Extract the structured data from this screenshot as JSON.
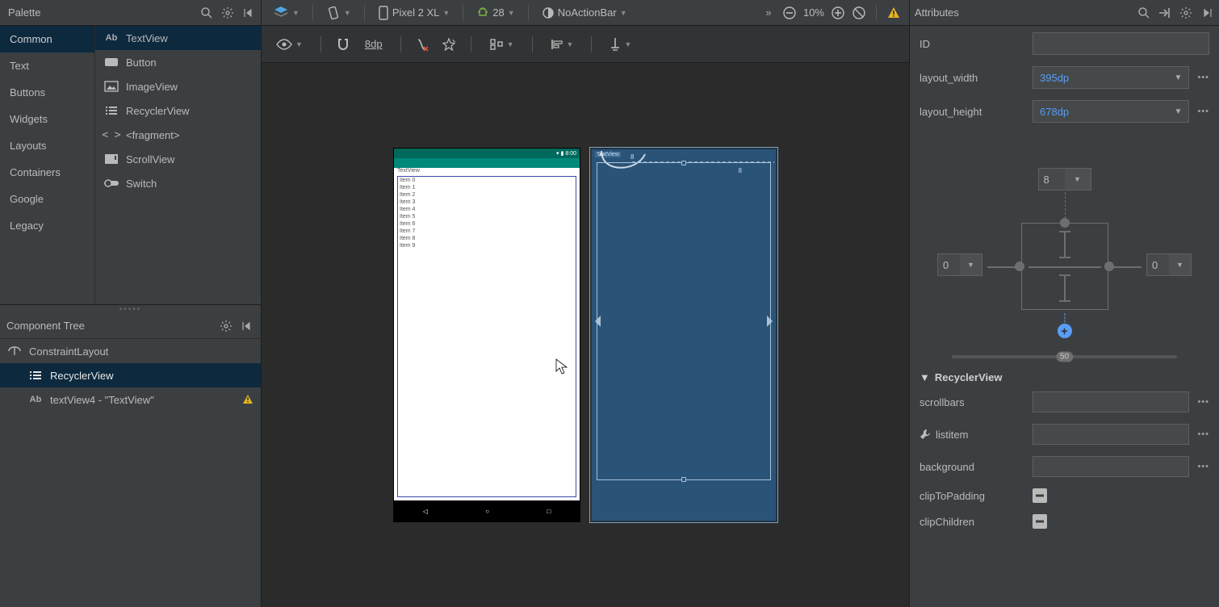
{
  "toolbar": {
    "palette_title": "Palette",
    "device": "Pixel 2 XL",
    "api": "28",
    "theme": "NoActionBar",
    "zoom": "10%",
    "default_margin": "8dp",
    "attributes_title": "Attributes"
  },
  "palette": {
    "categories": [
      "Common",
      "Text",
      "Buttons",
      "Widgets",
      "Layouts",
      "Containers",
      "Google",
      "Legacy"
    ],
    "active_category": 0,
    "items": [
      {
        "icon": "Ab",
        "label": "TextView"
      },
      {
        "icon": "btn",
        "label": "Button"
      },
      {
        "icon": "img",
        "label": "ImageView"
      },
      {
        "icon": "list",
        "label": "RecyclerView"
      },
      {
        "icon": "code",
        "label": "<fragment>"
      },
      {
        "icon": "scroll",
        "label": "ScrollView"
      },
      {
        "icon": "switch",
        "label": "Switch"
      }
    ],
    "selected_item": 0
  },
  "component_tree": {
    "title": "Component Tree",
    "rows": [
      {
        "icon": "constr",
        "label": "ConstraintLayout",
        "depth": 0,
        "warn": false
      },
      {
        "icon": "list",
        "label": "RecyclerView",
        "depth": 1,
        "warn": false,
        "selected": true
      },
      {
        "icon": "Ab",
        "label": "textView4 -  \"TextView\"",
        "depth": 1,
        "warn": true
      }
    ]
  },
  "device_preview": {
    "status_time": "8:00",
    "textview_label": "TextView",
    "items": [
      "Item 0",
      "Item 1",
      "Item 2",
      "Item 3",
      "Item 4",
      "Item 5",
      "Item 6",
      "Item 7",
      "Item 8",
      "Item 9"
    ]
  },
  "blueprint": {
    "textview_label": "TextView",
    "margin_top": "8",
    "margin_right": "8"
  },
  "attributes": {
    "id_label": "ID",
    "id_value": "",
    "layout_width_label": "layout_width",
    "layout_width_value": "395dp",
    "layout_height_label": "layout_height",
    "layout_height_value": "678dp",
    "constraint": {
      "top": "8",
      "left": "0",
      "right": "0",
      "slider": "50"
    },
    "section_title": "RecyclerView",
    "scrollbars_label": "scrollbars",
    "listitem_label": "listitem",
    "background_label": "background",
    "clipToPadding_label": "clipToPadding",
    "clipChildren_label": "clipChildren"
  }
}
